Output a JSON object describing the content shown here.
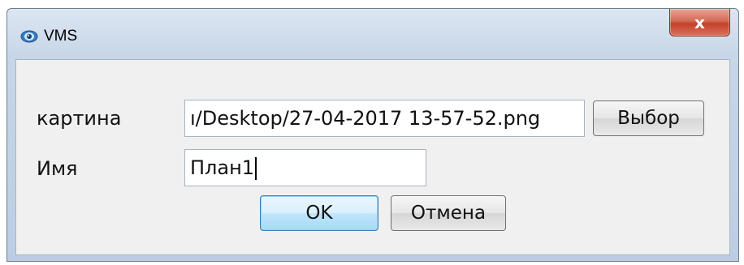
{
  "background_strip": {
    "text": ""
  },
  "window": {
    "title": "VMS",
    "icon": "camera-eye-icon",
    "close_label": "x"
  },
  "form": {
    "picture_label": "картина",
    "picture_value": "ı/Desktop/27-04-2017 13-57-52.png",
    "browse_label": "Выбор",
    "name_label": "Имя",
    "name_value": "План1"
  },
  "buttons": {
    "ok_label": "OK",
    "cancel_label": "Отмена"
  },
  "colors": {
    "close_button": "#c4412a",
    "title_bar": "#c7d6e8",
    "client_area": "#f0f0f0",
    "default_button_border": "#3c7fb1"
  }
}
